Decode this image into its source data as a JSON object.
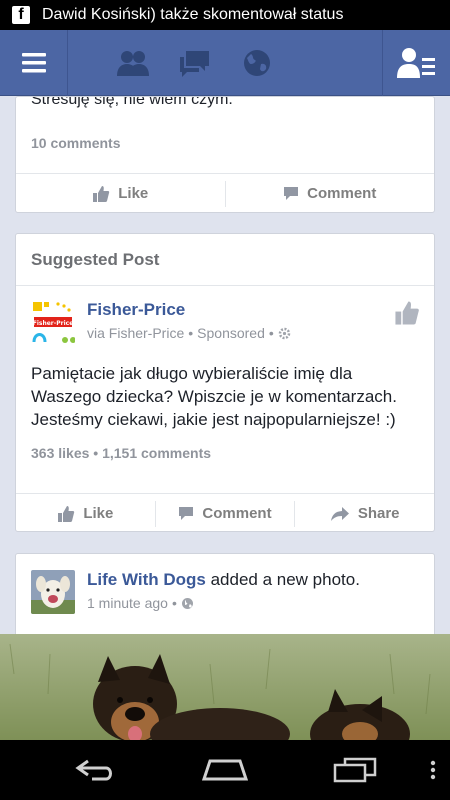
{
  "statusbar": {
    "app_badge": "f",
    "notification": "Dawid Kosiński) także skomentował status"
  },
  "nav": {
    "icons": [
      "menu-icon",
      "friend-requests-icon",
      "messages-icon",
      "notifications-globe-icon",
      "friends-list-icon"
    ]
  },
  "card1": {
    "prev_text": "Stresuję się, nie wiem czym.",
    "comments": "10 comments",
    "like_label": "Like",
    "comment_label": "Comment"
  },
  "card2": {
    "section_title": "Suggested Post",
    "page_name": "Fisher-Price",
    "avatar_label": "Fisher-Price",
    "via": "via Fisher-Price",
    "sponsored": "Sponsored",
    "body": "Pamiętacie jak długo wybieraliście imię dla Waszego dziecka? Wpiszcie je w komentarzach. Jesteśmy ciekawi, jakie jest najpopularniejsze! :)",
    "likes": "363 likes",
    "comments": "1,151 comments",
    "like_label": "Like",
    "comment_label": "Comment",
    "share_label": "Share"
  },
  "card3": {
    "page_name": "Life With Dogs",
    "action": "added a new photo.",
    "time": "1 minute ago"
  },
  "colors": {
    "nav_blue": "#4c66a4",
    "link_blue": "#3b5998",
    "feed_bg": "#dfe3ee"
  }
}
